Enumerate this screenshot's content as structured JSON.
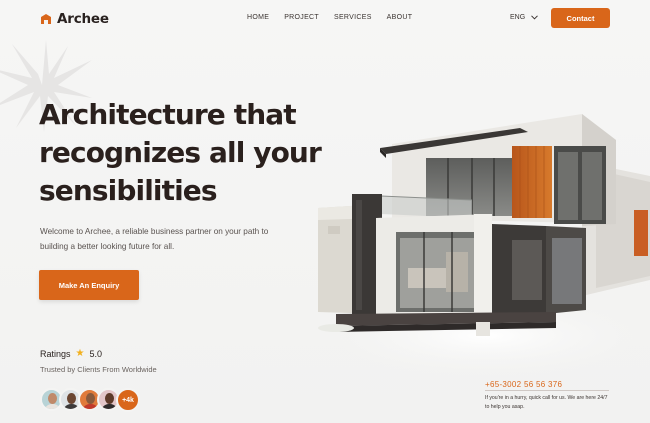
{
  "brand": {
    "name": "Archee",
    "accent": "#d9661a"
  },
  "nav": {
    "items": [
      {
        "label": "HOME"
      },
      {
        "label": "PROJECT"
      },
      {
        "label": "SERVICES"
      },
      {
        "label": "ABOUT"
      }
    ],
    "language": "ENG",
    "contact_label": "Contact"
  },
  "hero": {
    "headline_lines": [
      "Architecture that",
      "recognizes all your",
      "sensibilities"
    ],
    "subtext": "Welcome to Archee, a reliable business partner on your path to building a better looking future for all.",
    "cta_label": "Make An Enquiry"
  },
  "ratings": {
    "label": "Ratings",
    "score": "5.0",
    "trusted_text": "Trusted by Clients From Worldwide",
    "extra_count": "+4k"
  },
  "contact_info": {
    "phone": "+65-3002 56 56 376",
    "note": "If you're in a hurry, quick call for us. We are here 24/7 to help you asap."
  },
  "icons": [
    "logo-icon",
    "chevron-down-icon",
    "star-icon",
    "starburst-icon"
  ]
}
